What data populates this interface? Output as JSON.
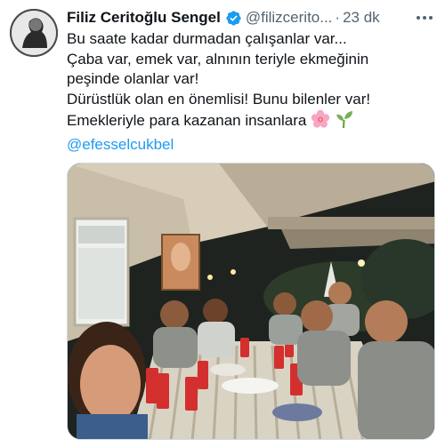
{
  "tweet": {
    "author": {
      "display_name": "Filiz Ceritoğlu Sengel",
      "handle": "@filizcerito...",
      "verified": true
    },
    "separator": "·",
    "timestamp": "23 dk",
    "text_lines": [
      "Bu saate kadar durmadan çalışanlar var...",
      "Çaba var, emek var, alnının teriyle ekmeğinin",
      "peşinde olanlar var!",
      "Dürüstlük olan en önemlisi! Bunu bilenler var!",
      "Emekleriyle para kazanan insanlara"
    ],
    "emojis": [
      "cherry-blossom",
      "seedling"
    ],
    "mention": "@efesselcukbel",
    "media": {
      "type": "photo",
      "description_icon": "photo"
    }
  },
  "colors": {
    "text": "#0f1419",
    "secondary": "#536471",
    "link": "#1d9bf0",
    "verified": "#1d9bf0",
    "border": "#cfd9de"
  },
  "icons": {
    "verified": "verified-badge-icon",
    "more": "more-horizontal-icon"
  }
}
